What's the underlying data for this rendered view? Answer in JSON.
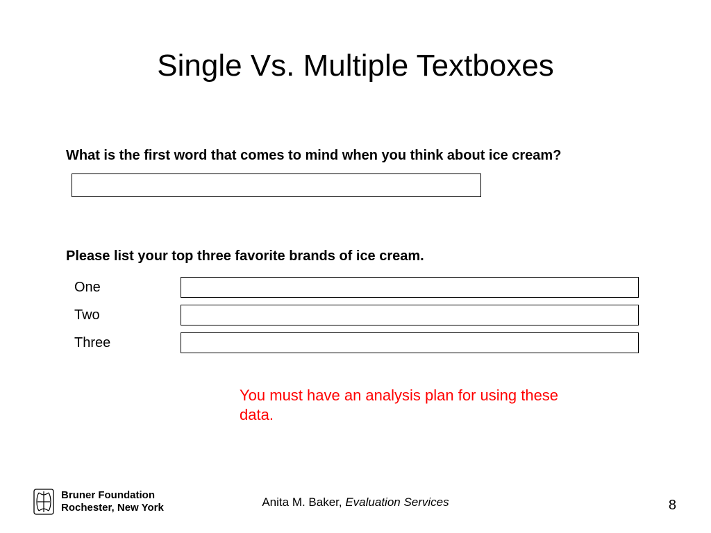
{
  "title": "Single Vs. Multiple Textboxes",
  "q1": {
    "label": "What is the first word that comes to mind when you think about ice cream?",
    "value": ""
  },
  "q2": {
    "label": "Please list your top three favorite brands of ice cream.",
    "rows": [
      {
        "label": "One",
        "value": ""
      },
      {
        "label": "Two",
        "value": ""
      },
      {
        "label": "Three",
        "value": ""
      }
    ]
  },
  "note": "You must have an analysis plan for using these data.",
  "footer": {
    "org_line1": "Bruner Foundation",
    "org_line2": "Rochester, New York",
    "author": "Anita M. Baker, ",
    "author_affil": "Evaluation Services",
    "page": "8"
  }
}
